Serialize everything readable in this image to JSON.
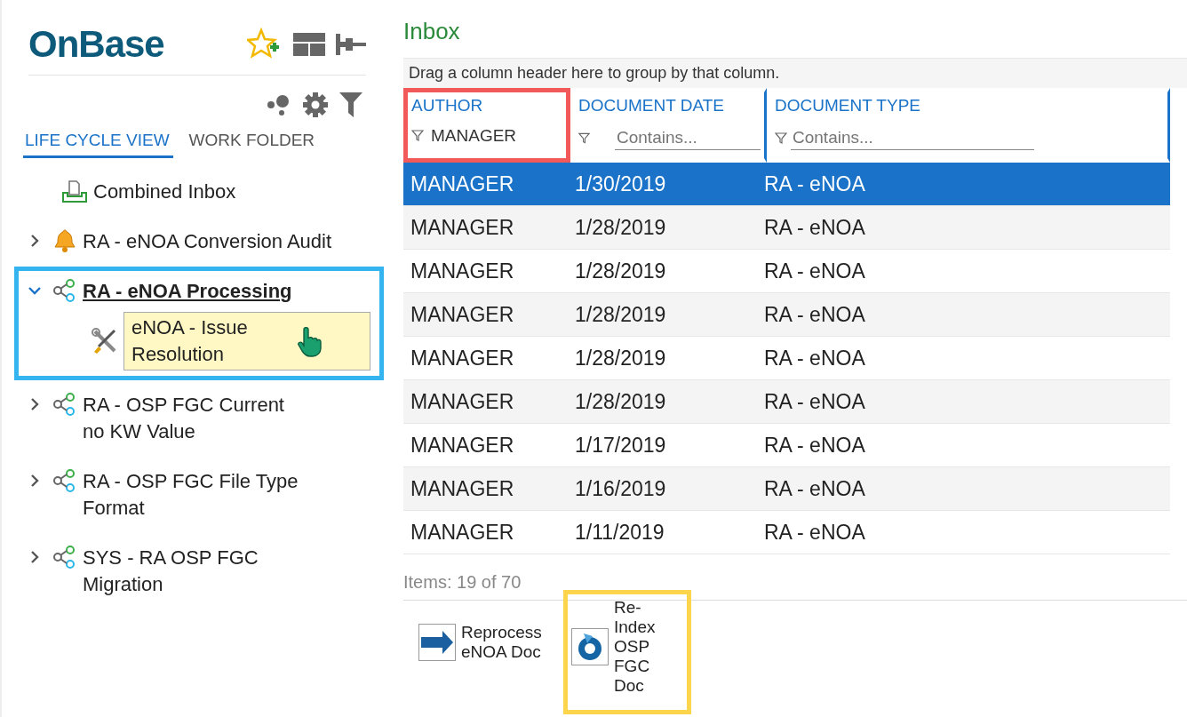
{
  "logo": {
    "text": "OnBase"
  },
  "tabs": [
    {
      "label": "LIFE CYCLE VIEW",
      "selected": true
    },
    {
      "label": "WORK FOLDER",
      "selected": false
    }
  ],
  "tree": [
    {
      "label": "Combined Inbox",
      "kind": "inbox"
    },
    {
      "label": "RA - eNOA Conversion Audit",
      "kind": "alert",
      "expanded": false,
      "selected": false,
      "highlighted": false
    },
    {
      "label": "RA - eNOA Processing",
      "kind": "lifecycle",
      "expanded": true,
      "selected": true,
      "highlighted": true,
      "children": [
        {
          "label": "eNOA - Issue Resolution",
          "hovered": true
        }
      ]
    },
    {
      "label": "RA - OSP FGC Current no KW Value",
      "kind": "lifecycle",
      "expanded": false,
      "selected": false,
      "highlighted": false
    },
    {
      "label": "RA - OSP FGC File Type Format",
      "kind": "lifecycle",
      "expanded": false,
      "selected": false,
      "highlighted": false
    },
    {
      "label": "SYS - RA OSP FGC Migration",
      "kind": "lifecycle",
      "expanded": false,
      "selected": false,
      "highlighted": false
    }
  ],
  "inbox": {
    "title": "Inbox",
    "group_hint": "Drag a column header here to group by that column.",
    "columns": [
      {
        "label": "AUTHOR",
        "filter_value": "MANAGER",
        "highlighted": true
      },
      {
        "label": "DOCUMENT DATE",
        "filter_placeholder": "Contains...",
        "highlighted": false
      },
      {
        "label": "DOCUMENT TYPE",
        "filter_placeholder": "Contains...",
        "highlighted": false
      }
    ],
    "rows": [
      {
        "cells": [
          "MANAGER",
          "1/30/2019",
          "RA - eNOA"
        ],
        "selected": true
      },
      {
        "cells": [
          "MANAGER",
          "1/28/2019",
          "RA - eNOA"
        ],
        "selected": false
      },
      {
        "cells": [
          "MANAGER",
          "1/28/2019",
          "RA - eNOA"
        ],
        "selected": false
      },
      {
        "cells": [
          "MANAGER",
          "1/28/2019",
          "RA - eNOA"
        ],
        "selected": false
      },
      {
        "cells": [
          "MANAGER",
          "1/28/2019",
          "RA - eNOA"
        ],
        "selected": false
      },
      {
        "cells": [
          "MANAGER",
          "1/28/2019",
          "RA - eNOA"
        ],
        "selected": false
      },
      {
        "cells": [
          "MANAGER",
          "1/17/2019",
          "RA - eNOA"
        ],
        "selected": false
      },
      {
        "cells": [
          "MANAGER",
          "1/16/2019",
          "RA - eNOA"
        ],
        "selected": false
      },
      {
        "cells": [
          "MANAGER",
          "1/11/2019",
          "RA - eNOA"
        ],
        "selected": false
      }
    ],
    "count": "Items: 19 of 70"
  },
  "actions": [
    {
      "label": "Reprocess eNOA Doc",
      "kind": "arrow",
      "highlighted": false
    },
    {
      "label": "Re-Index OSP FGC Doc",
      "kind": "reindex",
      "highlighted": true
    }
  ]
}
